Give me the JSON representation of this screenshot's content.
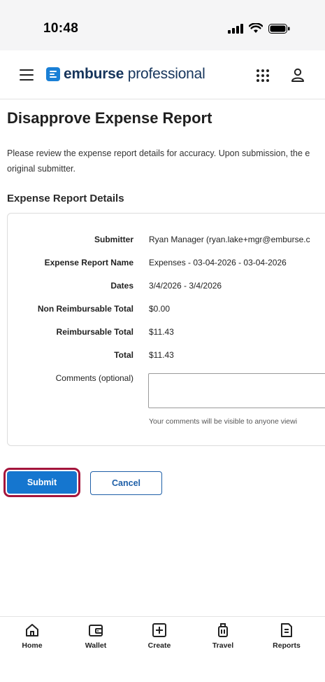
{
  "status_bar": {
    "time": "10:48"
  },
  "header": {
    "brand_bold": "emburse",
    "brand_light": " professional"
  },
  "page": {
    "title": "Disapprove Expense Report",
    "intro_line1": "Please review the expense report details for accuracy. Upon submission, the e",
    "intro_line2": "original submitter.",
    "section_title": "Expense Report Details"
  },
  "details": {
    "rows": [
      {
        "label": "Submitter",
        "value": "Ryan Manager (ryan.lake+mgr@emburse.c"
      },
      {
        "label": "Expense Report Name",
        "value": "Expenses - 03-04-2026 - 03-04-2026"
      },
      {
        "label": "Dates",
        "value": "3/4/2026 - 3/4/2026"
      },
      {
        "label": "Non Reimbursable Total",
        "value": "$0.00"
      },
      {
        "label": "Reimbursable Total",
        "value": "$11.43"
      },
      {
        "label": "Total",
        "value": "$11.43"
      }
    ],
    "comments_label": "Comments (optional)",
    "comments_value": "",
    "comments_hint": "Your comments will be visible to anyone viewi"
  },
  "actions": {
    "submit_label": "Submit",
    "cancel_label": "Cancel"
  },
  "tabs": [
    {
      "label": "Home",
      "icon": "home-icon"
    },
    {
      "label": "Wallet",
      "icon": "wallet-icon"
    },
    {
      "label": "Create",
      "icon": "plus-square-icon"
    },
    {
      "label": "Travel",
      "icon": "luggage-icon"
    },
    {
      "label": "Reports",
      "icon": "report-icon"
    }
  ],
  "colors": {
    "primary": "#1576cf",
    "brand_text": "#16355c",
    "focus_outline": "#a4153c"
  }
}
